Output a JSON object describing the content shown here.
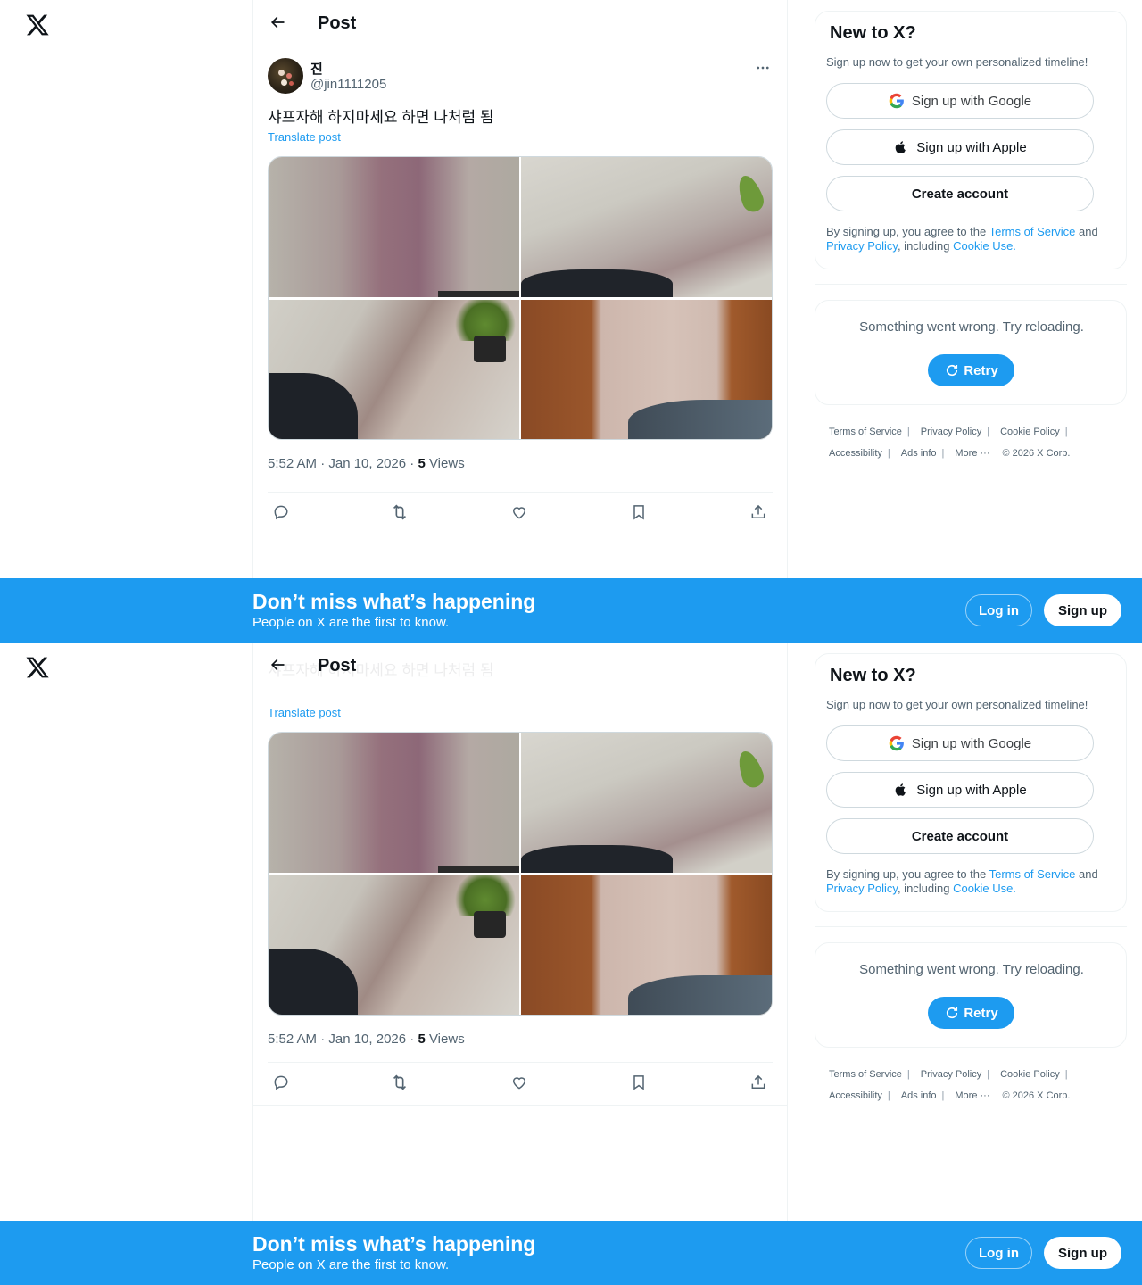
{
  "header": {
    "title": "Post"
  },
  "post": {
    "display_name": "진",
    "handle": "@jin1111205",
    "text": "샤프자해 하지마세요 하면 나처럼 됨",
    "translate_label": "Translate post",
    "time": "5:52 AM · Jan 10, 2026 · ",
    "views_count": "5",
    "views_label": " Views"
  },
  "sidebar": {
    "signup": {
      "title": "New to X?",
      "subtitle": "Sign up now to get your own personalized timeline!",
      "google_label": "Sign up with Google",
      "apple_label": "Sign up with Apple",
      "create_label": "Create account",
      "legal_prefix": "By signing up, you agree to the ",
      "terms_link": "Terms of Service",
      "legal_and": " and ",
      "privacy_link": "Privacy Policy",
      "legal_including": ", including ",
      "cookie_link": "Cookie Use.",
      "legal_suffix": ""
    },
    "error": {
      "message": "Something went wrong. Try reloading.",
      "retry_label": "Retry"
    },
    "footer": {
      "terms": "Terms of Service",
      "privacy": "Privacy Policy",
      "cookie": "Cookie Policy",
      "accessibility": "Accessibility",
      "ads": "Ads info",
      "more": "More ···",
      "copyright": "© 2026 X Corp."
    }
  },
  "banner": {
    "title": "Don’t miss what’s happening",
    "subtitle": "People on X are the first to know.",
    "login_label": "Log in",
    "signup_label": "Sign up"
  },
  "colors": {
    "accent": "#1d9bf0",
    "text": "#0f1419",
    "secondary": "#536471",
    "border": "#eff3f4"
  },
  "icons": {
    "logo": "x-logo-icon",
    "back": "arrow-left-icon",
    "more": "more-horizontal-icon",
    "reply": "reply-icon",
    "repost": "repost-icon",
    "like": "heart-icon",
    "bookmark": "bookmark-icon",
    "share": "share-icon",
    "google": "google-icon",
    "apple": "apple-icon",
    "retry": "refresh-icon"
  }
}
